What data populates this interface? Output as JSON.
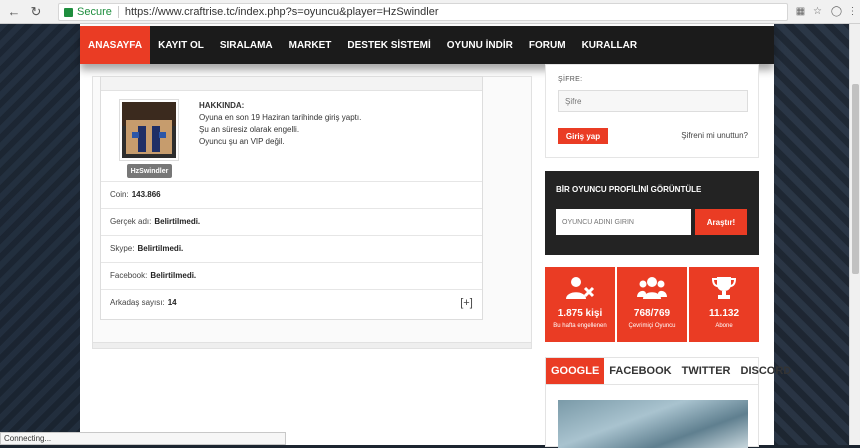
{
  "browser": {
    "secure_label": "Secure",
    "url": "https://www.craftrise.tc/index.php?s=oyuncu&player=HzSwindler",
    "status": "Connecting..."
  },
  "nav": {
    "items": [
      "ANASAYFA",
      "KAYIT OL",
      "SIRALAMA",
      "MARKET",
      "DESTEK SİSTEMİ",
      "OYUNU İNDİR",
      "FORUM",
      "KURALLAR"
    ]
  },
  "profile": {
    "username": "HzSwindler",
    "about_title": "HAKKINDA:",
    "about_lines": [
      "Oyuna en son 19 Haziran tarihinde giriş yaptı.",
      "Şu an süresiz olarak engelli.",
      "Oyuncu şu an VIP değil."
    ],
    "rows": [
      {
        "label": "Coin:",
        "value": "143.866"
      },
      {
        "label": "Gerçek adı:",
        "value": "Belirtilmedi."
      },
      {
        "label": "Skype:",
        "value": "Belirtilmedi."
      },
      {
        "label": "Facebook:",
        "value": "Belirtilmedi."
      },
      {
        "label": "Arkadaş sayısı:",
        "value": "14"
      }
    ],
    "expand_label": "[+]"
  },
  "login": {
    "password_label": "ŞİFRE:",
    "password_placeholder": "Şifre",
    "submit_label": "Giriş yap",
    "forgot_label": "Şifreni mi unuttun?"
  },
  "player_search": {
    "title": "BİR OYUNCU PROFİLİNİ GÖRÜNTÜLE",
    "placeholder": "OYUNCU ADINI GİRİN",
    "button_label": "Araştır!"
  },
  "stats": [
    {
      "icon": "user-banned-icon",
      "value": "1.875 kişi",
      "label": "Bu hafta engellenen"
    },
    {
      "icon": "users-icon",
      "value": "768/769",
      "label": "Çevrimiçi Oyuncu"
    },
    {
      "icon": "trophy-icon",
      "value": "11.132",
      "label": "Abone"
    }
  ],
  "social": {
    "tabs": [
      "GOOGLE",
      "FACEBOOK",
      "TWITTER",
      "DISCORD"
    ]
  },
  "colors": {
    "accent": "#ea3c24",
    "dark": "#1b1b1b"
  }
}
